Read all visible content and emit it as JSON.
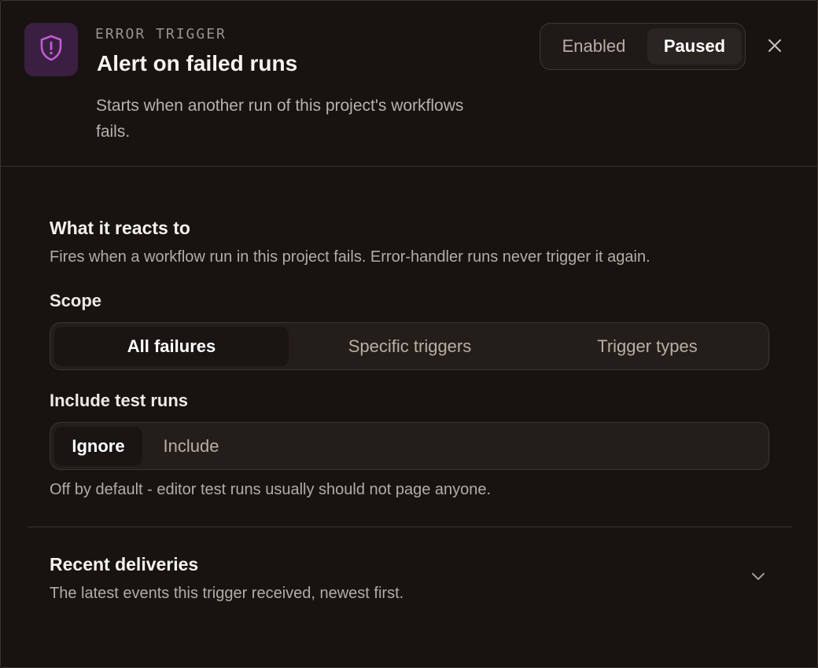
{
  "header": {
    "icon": "shield-alert-icon",
    "eyebrow": "ERROR TRIGGER",
    "title": "Alert on failed runs",
    "description": "Starts when another run of this project's workflows fails.",
    "status_toggle": {
      "options": [
        "Enabled",
        "Paused"
      ],
      "selected": "Paused"
    },
    "close_icon": "close-icon"
  },
  "reacts": {
    "heading": "What it reacts to",
    "description": "Fires when a workflow run in this project fails. Error-handler runs never trigger it again."
  },
  "scope": {
    "label": "Scope",
    "options": [
      "All failures",
      "Specific triggers",
      "Trigger types"
    ],
    "selected": "All failures"
  },
  "test_runs": {
    "label": "Include test runs",
    "options": [
      "Ignore",
      "Include"
    ],
    "selected": "Ignore",
    "hint": "Off by default - editor test runs usually should not page anyone."
  },
  "deliveries": {
    "heading": "Recent deliveries",
    "description": "The latest events this trigger received, newest first.",
    "expand_icon": "chevron-down-icon"
  },
  "colors": {
    "background": "#171311",
    "accent": "#c25ad8",
    "icon_tile": "#3a1f40",
    "border": "#3a322d"
  }
}
